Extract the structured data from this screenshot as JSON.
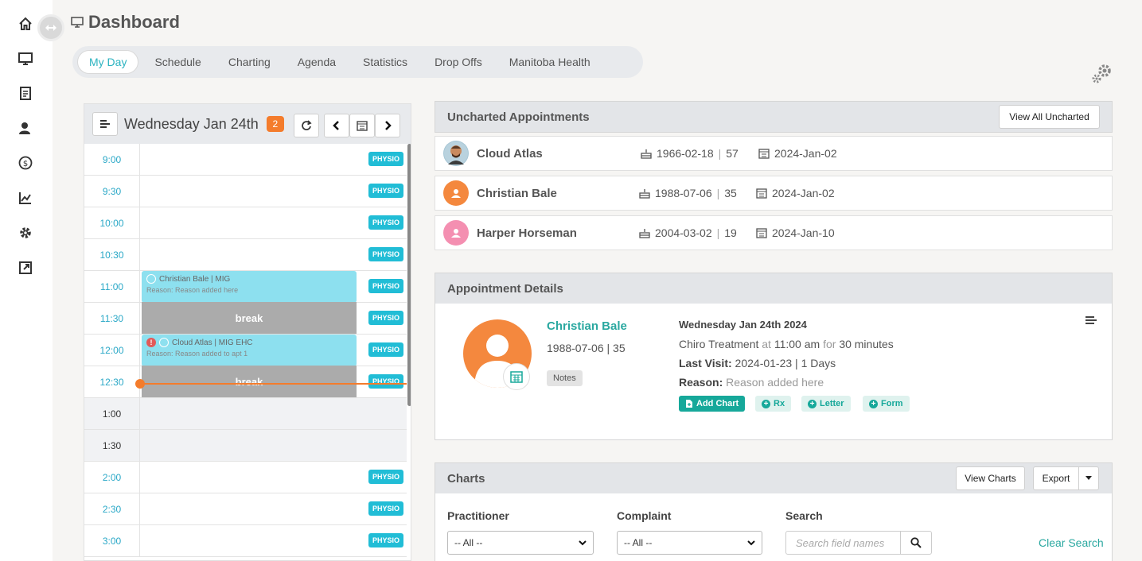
{
  "header": {
    "title": "Dashboard"
  },
  "tabs": [
    "My Day",
    "Schedule",
    "Charting",
    "Agenda",
    "Statistics",
    "Drop Offs",
    "Manitoba Health"
  ],
  "rail_icons": [
    "home-icon",
    "monitor-icon",
    "clipboard-icon",
    "users-icon",
    "dollar-icon",
    "chart-icon",
    "gear-icon",
    "external-link-icon"
  ],
  "calendar": {
    "date_label": "Wednesday Jan 24th",
    "badge_count": "2",
    "slots": [
      {
        "time": "9:00",
        "tag": "PHYSIO"
      },
      {
        "time": "9:30",
        "tag": "PHYSIO"
      },
      {
        "time": "10:00",
        "tag": "PHYSIO"
      },
      {
        "time": "10:30",
        "tag": "PHYSIO"
      },
      {
        "time": "11:00",
        "tag": "PHYSIO"
      },
      {
        "time": "11:30",
        "tag": "PHYSIO"
      },
      {
        "time": "12:00",
        "tag": "PHYSIO"
      },
      {
        "time": "12:30",
        "tag": "PHYSIO"
      },
      {
        "time": "1:00",
        "tag": ""
      },
      {
        "time": "1:30",
        "tag": ""
      },
      {
        "time": "2:00",
        "tag": "PHYSIO"
      },
      {
        "time": "2:30",
        "tag": "PHYSIO"
      },
      {
        "time": "3:00",
        "tag": "PHYSIO"
      }
    ],
    "appointments": [
      {
        "title": "Christian Bale | MIG",
        "reason": "Reason: Reason added here"
      },
      {
        "title": "Cloud Atlas | MIG EHC",
        "reason": "Reason: Reason added to apt 1"
      }
    ],
    "break_label": "break"
  },
  "uncharted": {
    "title": "Uncharted Appointments",
    "view_all": "View All Uncharted",
    "rows": [
      {
        "name": "Cloud Atlas",
        "dob": "1966-02-18",
        "age": "57",
        "date": "2024-Jan-02"
      },
      {
        "name": "Christian Bale",
        "dob": "1988-07-06",
        "age": "35",
        "date": "2024-Jan-02"
      },
      {
        "name": "Harper Horseman",
        "dob": "2004-03-02",
        "age": "19",
        "date": "2024-Jan-10"
      }
    ]
  },
  "details": {
    "title": "Appointment Details",
    "name": "Christian Bale",
    "dob_line": "1988-07-06 | 35",
    "notes": "Notes",
    "date": "Wednesday Jan 24th 2024",
    "treatment": "Chiro Treatment",
    "at": "at",
    "time": "11:00 am",
    "for": "for",
    "duration": "30 minutes",
    "last_visit_label": "Last Visit:",
    "last_visit": "2024-01-23 | 1 Days",
    "reason_label": "Reason:",
    "reason": "Reason added here",
    "actions": [
      "Add Chart",
      "Rx",
      "Letter",
      "Form"
    ]
  },
  "charts": {
    "title": "Charts",
    "view_charts": "View Charts",
    "export": "Export",
    "practitioner_label": "Practitioner",
    "practitioner_value": "-- All --",
    "complaint_label": "Complaint",
    "complaint_value": "-- All --",
    "search_label": "Search",
    "search_placeholder": "Search field names",
    "clear": "Clear Search"
  },
  "colors": {
    "accent": "#2bb3c0",
    "orange": "#f47c2c",
    "physio": "#21bdd6",
    "teal": "#16a89a",
    "pink": "#f48fb1"
  }
}
